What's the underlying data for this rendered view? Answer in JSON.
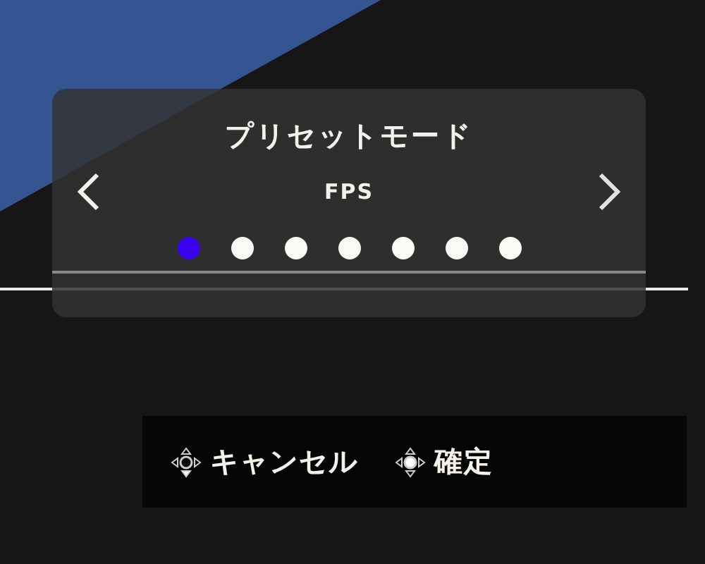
{
  "preset": {
    "title": "プリセットモード",
    "value": "FPS",
    "dots": [
      {
        "selected": true
      },
      {
        "selected": false
      },
      {
        "selected": false
      },
      {
        "selected": false
      },
      {
        "selected": false
      },
      {
        "selected": false
      },
      {
        "selected": false
      }
    ]
  },
  "hints": [
    {
      "kind": "down",
      "label": "キャンセル"
    },
    {
      "kind": "center",
      "label": "確定"
    }
  ]
}
